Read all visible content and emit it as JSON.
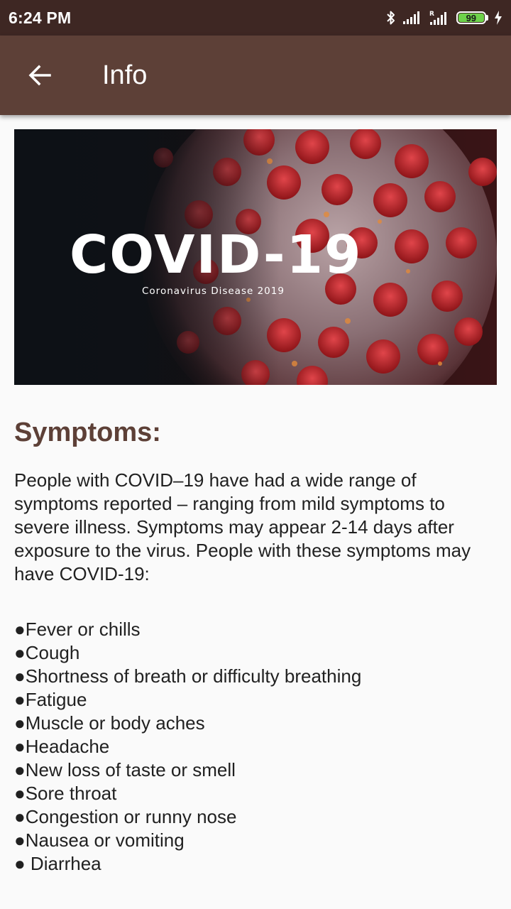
{
  "status_bar": {
    "time": "6:24 PM",
    "battery_level": "99",
    "icons": [
      "bluetooth-icon",
      "signal-icon",
      "roaming-signal-icon",
      "battery-icon",
      "charging-icon"
    ]
  },
  "app_bar": {
    "title": "Info",
    "back_icon": "arrow-left-icon",
    "color": "#5d4037"
  },
  "hero": {
    "title": "COVID-19",
    "subtitle": "Coronavirus Disease 2019"
  },
  "content": {
    "section_title": "Symptoms:",
    "intro": "People with COVID–19 have had a wide range of symptoms reported – ranging from mild symptoms to severe illness. Symptoms may appear 2-14 days after exposure to the virus. People with these symptoms may have COVID-19:",
    "symptoms": [
      "●Fever or chills",
      "●Cough",
      "●Shortness of breath or difficulty breathing",
      "●Fatigue",
      "●Muscle or body aches",
      "●Headache",
      "●New loss of taste or smell",
      "●Sore throat",
      "●Congestion or runny nose",
      "●Nausea or vomiting",
      "● Diarrhea"
    ]
  },
  "colors": {
    "status_bar": "#3e2723",
    "accent": "#5d4037",
    "text": "#212121",
    "background": "#fafafa"
  }
}
